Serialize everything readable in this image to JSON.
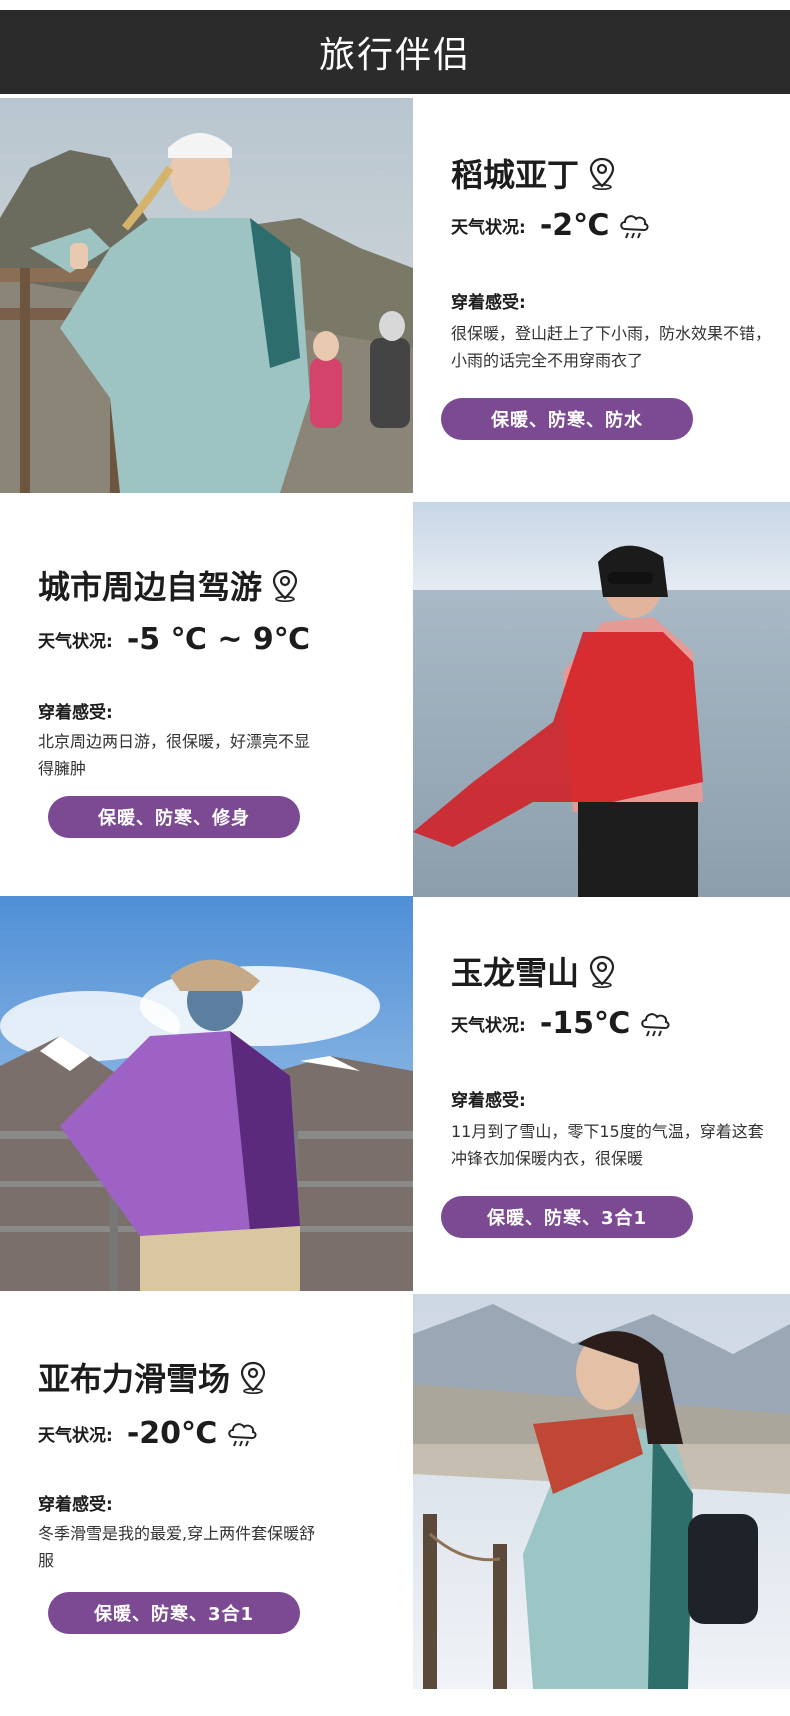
{
  "header": {
    "title": "旅行伴侣"
  },
  "labels": {
    "weather_label": "天气状况:",
    "feel_label": "穿着感受:"
  },
  "sections": [
    {
      "place": "稻城亚丁",
      "temperature": "-2℃",
      "feel_text": "很保暖，登山赶上了下小雨，防水效果不错，小雨的话完全不用穿雨衣了",
      "tags": "保暖、防寒、防水",
      "photo": "woman-teal-jacket-mountain-trail",
      "weather_icon": "rain-cloud-icon"
    },
    {
      "place": "城市周边自驾游",
      "temperature": "-5 ℃ ~ 9℃",
      "feel_text": "北京周边两日游，很保暖，好漂亮不显得臃肿",
      "tags": "保暖、防寒、修身",
      "photo": "woman-pink-jacket-red-scarf-lake",
      "weather_icon": null
    },
    {
      "place": "玉龙雪山",
      "temperature": "-15℃",
      "feel_text": "11月到了雪山，零下15度的气温，穿着这套冲锋衣加保暖内衣，很保暖",
      "tags": "保暖、防寒、3合1",
      "photo": "person-purple-jacket-snow-mountains",
      "weather_icon": "rain-cloud-icon"
    },
    {
      "place": "亚布力滑雪场",
      "temperature": "-20℃",
      "feel_text": "冬季滑雪是我的最爱,穿上两件套保暖舒服",
      "tags": "保暖、防寒、3合1",
      "photo": "woman-teal-jacket-snowy-forest",
      "weather_icon": "rain-cloud-icon"
    }
  ],
  "colors": {
    "header_bg": "#2b2b2b",
    "tag_bg": "#7b4a93"
  }
}
